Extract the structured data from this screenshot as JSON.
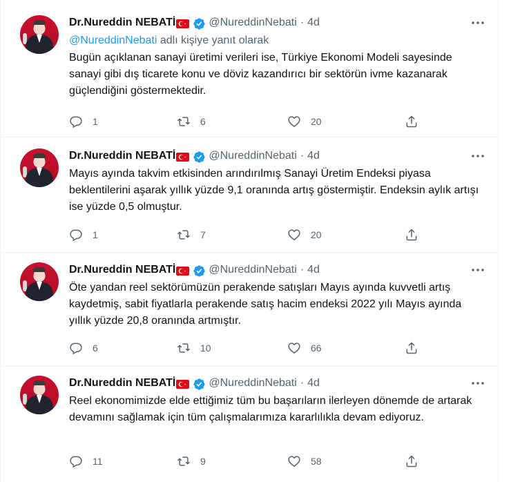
{
  "tweets": [
    {
      "name": "Dr.Nureddin NEBATİ",
      "handle": "@NureddinNebati",
      "dot": "·",
      "time": "4d",
      "reply_mention": "@NureddinNebati",
      "reply_suffix": " adlı kişiye yanıt olarak",
      "text": "Bugün açıklanan sanayi üretimi verileri ise, Türkiye Ekonomi Modeli sayesinde sanayi gibi dış ticarete konu ve döviz kazandırıcı bir sektörün ivme kazanarak güçlendiğini göstermektedir.",
      "replies": "1",
      "retweets": "6",
      "likes": "20"
    },
    {
      "name": "Dr.Nureddin NEBATİ",
      "handle": "@NureddinNebati",
      "dot": "·",
      "time": "4d",
      "text": "Mayıs ayında takvim etkisinden arındırılmış Sanayi Üretim Endeksi piyasa beklentilerini aşarak yıllık yüzde 9,1 oranında artış göstermiştir. Endeksin aylık artışı ise yüzde 0,5 olmuştur.",
      "replies": "1",
      "retweets": "7",
      "likes": "20"
    },
    {
      "name": "Dr.Nureddin NEBATİ",
      "handle": "@NureddinNebati",
      "dot": "·",
      "time": "4d",
      "text": "Öte yandan reel sektörümüzün perakende satışları Mayıs ayında kuvvetli artış kaydetmiş, sabit fiyatlarla perakende satış hacim endeksi 2022 yılı Mayıs ayında yıllık yüzde 20,8 oranında artmıştır.",
      "replies": "6",
      "retweets": "10",
      "likes": "66"
    },
    {
      "name": "Dr.Nureddin NEBATİ",
      "handle": "@NureddinNebati",
      "dot": "·",
      "time": "4d",
      "text": "Reel ekonomimizde elde ettiğimiz tüm bu başarıların ilerleyen dönemde de artarak devamını sağlamak için tüm çalışmalarımıza kararlılıkla devam ediyoruz.",
      "replies": "11",
      "retweets": "9",
      "likes": "58"
    }
  ],
  "colors": {
    "text": "#0f1419",
    "secondary": "#536471",
    "link": "#1d9bf0",
    "verified": "#1d9bf0",
    "flag": "#e30a17",
    "border": "#eff3f4"
  },
  "icons": [
    "turkish-flag-icon",
    "verified-badge-icon",
    "more-icon",
    "reply-icon",
    "retweet-icon",
    "like-icon",
    "share-icon"
  ]
}
